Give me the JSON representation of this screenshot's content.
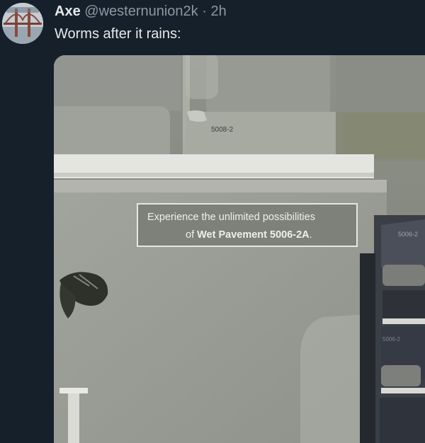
{
  "tweet": {
    "display_name": "Axe",
    "handle": "@westernunion2k",
    "separator": "·",
    "time": "2h",
    "text": "Worms after it rains:"
  },
  "media": {
    "chip_code_top": "5008-2",
    "promo_line1": "Experience the unlimited possibilities",
    "promo_line2_prefix": "of ",
    "promo_line2_bold": "Wet Pavement 5006-2A",
    "promo_line2_suffix": ".",
    "chip_code_right": "5006-2",
    "chip_code_right_lower": "5006-2"
  },
  "colors": {
    "background": "#15202b",
    "primary_text": "#e7e9ea",
    "secondary_text": "#8b98a5"
  }
}
